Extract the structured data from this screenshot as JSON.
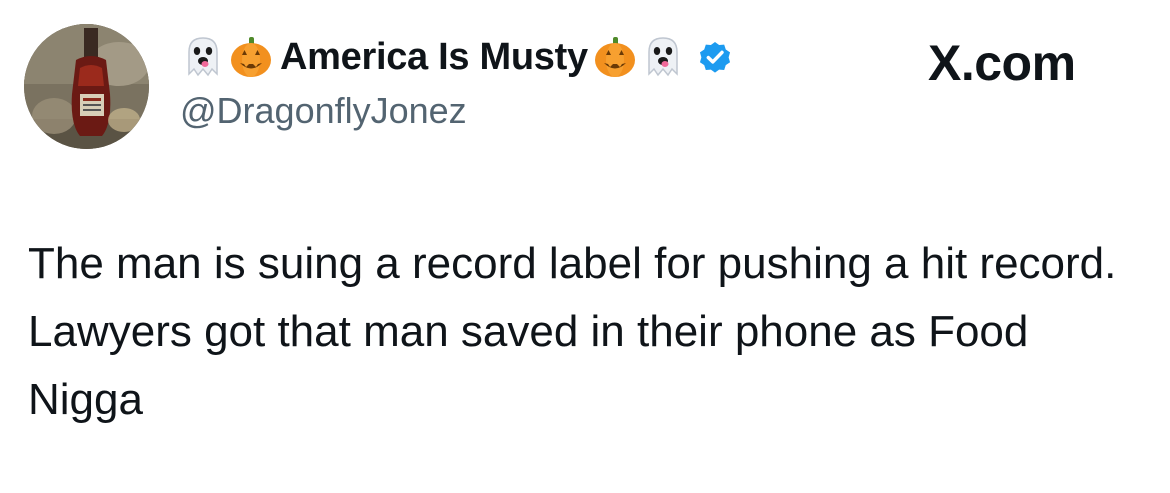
{
  "tweet": {
    "display_name": "America Is Musty",
    "handle": "@DragonflyJonez",
    "verified": true,
    "verified_color": "#1d9bf0",
    "name_emojis_before": [
      "ghost-icon",
      "pumpkin-icon"
    ],
    "name_emojis_after": [
      "pumpkin-icon",
      "ghost-icon"
    ],
    "text": "The man is suing a record label for pushing a hit record. Lawyers got that man saved in their phone as Food Nigga"
  },
  "source": {
    "label": "X.com"
  }
}
